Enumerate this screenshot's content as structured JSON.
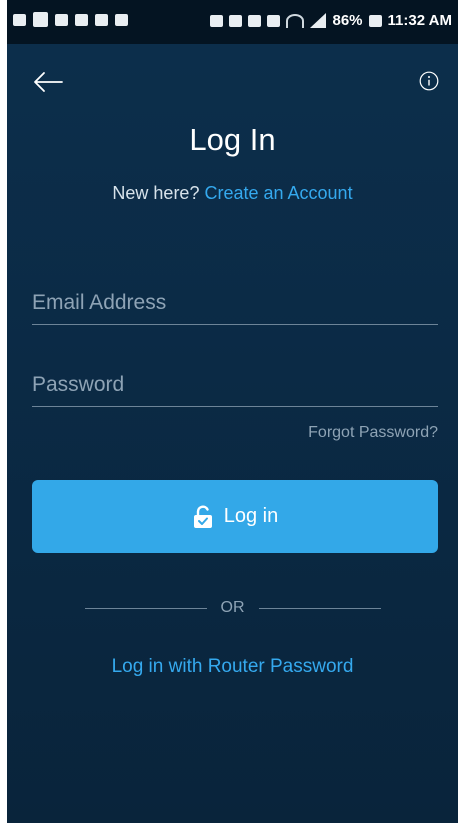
{
  "status_bar": {
    "battery": "86%",
    "time": "11:32 AM"
  },
  "header": {
    "back_icon": "arrow-left-icon",
    "info_icon": "info-circle-icon"
  },
  "title": "Log In",
  "signup": {
    "prompt": "New here?",
    "link": "Create an Account"
  },
  "form": {
    "email_placeholder": "Email Address",
    "email_value": "",
    "password_placeholder": "Password",
    "password_value": "",
    "forgot": "Forgot Password?",
    "login_button": "Log in",
    "login_icon": "unlock-icon"
  },
  "divider": "OR",
  "router_link": "Log in with Router Password",
  "colors": {
    "background": "#0b2a45",
    "accent": "#33a8e8",
    "link": "#35a9ee"
  }
}
